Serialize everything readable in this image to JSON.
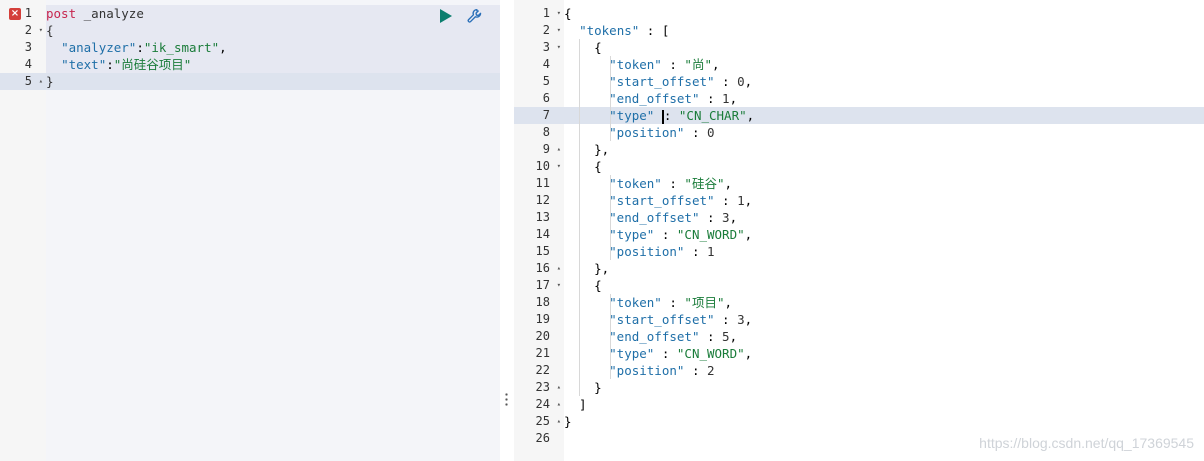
{
  "request_editor": {
    "error_marker": "×",
    "lines": [
      {
        "num": "1",
        "fold": ""
      },
      {
        "num": "2",
        "fold": "▾"
      },
      {
        "num": "3",
        "fold": ""
      },
      {
        "num": "4",
        "fold": ""
      },
      {
        "num": "5",
        "fold": "▴"
      }
    ],
    "method": "post",
    "endpoint": "_analyze",
    "open_brace": "{",
    "close_brace": "}",
    "analyzer_key": "\"analyzer\"",
    "analyzer_value": "\"ik_smart\"",
    "text_key": "\"text\"",
    "text_value": "\"尚硅谷项目\""
  },
  "toolbar": {
    "run_icon": "play-icon",
    "settings_icon": "wrench-icon"
  },
  "response_viewer": {
    "line_numbers": [
      "1",
      "2",
      "3",
      "4",
      "5",
      "6",
      "7",
      "8",
      "9",
      "10",
      "11",
      "12",
      "13",
      "14",
      "15",
      "16",
      "17",
      "18",
      "19",
      "20",
      "21",
      "22",
      "23",
      "24",
      "25",
      "26"
    ],
    "folds": [
      "▾",
      "▾",
      "▾",
      "",
      "",
      "",
      "",
      "",
      "▴",
      "▾",
      "",
      "",
      "",
      "",
      "",
      "▴",
      "▾",
      "",
      "",
      "",
      "",
      "",
      "▴",
      "▴",
      "▴",
      ""
    ],
    "tokens_key": "\"tokens\"",
    "items": [
      {
        "token": "\"尚\"",
        "start_offset": "0",
        "end_offset": "1",
        "type": "\"CN_CHAR\"",
        "position": "0"
      },
      {
        "token": "\"硅谷\"",
        "start_offset": "1",
        "end_offset": "3",
        "type": "\"CN_WORD\"",
        "position": "1"
      },
      {
        "token": "\"项目\"",
        "start_offset": "3",
        "end_offset": "5",
        "type": "\"CN_WORD\"",
        "position": "2"
      }
    ],
    "k_token": "\"token\"",
    "k_start": "\"start_offset\"",
    "k_end": "\"end_offset\"",
    "k_type": "\"type\"",
    "k_position": "\"position\""
  },
  "watermark": "https://blog.csdn.net/qq_17369545"
}
